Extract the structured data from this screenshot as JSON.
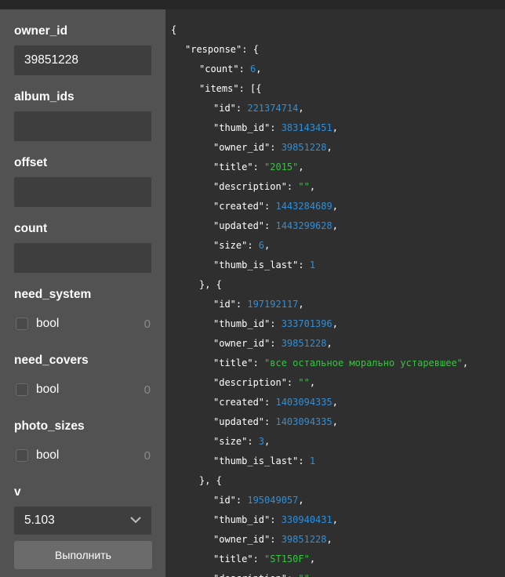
{
  "form": {
    "fields": [
      {
        "name": "owner_id",
        "type": "text",
        "value": "39851228"
      },
      {
        "name": "album_ids",
        "type": "text",
        "value": ""
      },
      {
        "name": "offset",
        "type": "text",
        "value": ""
      },
      {
        "name": "count",
        "type": "text",
        "value": ""
      },
      {
        "name": "need_system",
        "type": "bool",
        "label": "bool",
        "value": "0"
      },
      {
        "name": "need_covers",
        "type": "bool",
        "label": "bool",
        "value": "0"
      },
      {
        "name": "photo_sizes",
        "type": "bool",
        "label": "bool",
        "value": "0"
      },
      {
        "name": "v",
        "type": "select",
        "value": "5.103"
      }
    ],
    "run_label": "Выполнить"
  },
  "response_lines": [
    {
      "indent": 0,
      "parts": [
        {
          "t": "p",
          "s": "{"
        }
      ]
    },
    {
      "indent": 1,
      "parts": [
        {
          "t": "p",
          "s": "\"response\": {"
        }
      ]
    },
    {
      "indent": 2,
      "parts": [
        {
          "t": "p",
          "s": "\"count\": "
        },
        {
          "t": "n",
          "s": "6"
        },
        {
          "t": "p",
          "s": ","
        }
      ]
    },
    {
      "indent": 2,
      "parts": [
        {
          "t": "p",
          "s": "\"items\": [{"
        }
      ]
    },
    {
      "indent": 3,
      "parts": [
        {
          "t": "p",
          "s": "\"id\": "
        },
        {
          "t": "n",
          "s": "221374714"
        },
        {
          "t": "p",
          "s": ","
        }
      ]
    },
    {
      "indent": 3,
      "parts": [
        {
          "t": "p",
          "s": "\"thumb_id\": "
        },
        {
          "t": "n",
          "s": "383143451"
        },
        {
          "t": "p",
          "s": ","
        }
      ]
    },
    {
      "indent": 3,
      "parts": [
        {
          "t": "p",
          "s": "\"owner_id\": "
        },
        {
          "t": "n",
          "s": "39851228"
        },
        {
          "t": "p",
          "s": ","
        }
      ]
    },
    {
      "indent": 3,
      "parts": [
        {
          "t": "p",
          "s": "\"title\": "
        },
        {
          "t": "s",
          "s": "\"2015\""
        },
        {
          "t": "p",
          "s": ","
        }
      ]
    },
    {
      "indent": 3,
      "parts": [
        {
          "t": "p",
          "s": "\"description\": "
        },
        {
          "t": "s",
          "s": "\"\""
        },
        {
          "t": "p",
          "s": ","
        }
      ]
    },
    {
      "indent": 3,
      "parts": [
        {
          "t": "p",
          "s": "\"created\": "
        },
        {
          "t": "n",
          "s": "1443284689"
        },
        {
          "t": "p",
          "s": ","
        }
      ]
    },
    {
      "indent": 3,
      "parts": [
        {
          "t": "p",
          "s": "\"updated\": "
        },
        {
          "t": "n",
          "s": "1443299628"
        },
        {
          "t": "p",
          "s": ","
        }
      ]
    },
    {
      "indent": 3,
      "parts": [
        {
          "t": "p",
          "s": "\"size\": "
        },
        {
          "t": "n",
          "s": "6"
        },
        {
          "t": "p",
          "s": ","
        }
      ]
    },
    {
      "indent": 3,
      "parts": [
        {
          "t": "p",
          "s": "\"thumb_is_last\": "
        },
        {
          "t": "n",
          "s": "1"
        }
      ]
    },
    {
      "indent": 2,
      "parts": [
        {
          "t": "p",
          "s": "}, {"
        }
      ]
    },
    {
      "indent": 3,
      "parts": [
        {
          "t": "p",
          "s": "\"id\": "
        },
        {
          "t": "n",
          "s": "197192117"
        },
        {
          "t": "p",
          "s": ","
        }
      ]
    },
    {
      "indent": 3,
      "parts": [
        {
          "t": "p",
          "s": "\"thumb_id\": "
        },
        {
          "t": "n",
          "s": "333701396"
        },
        {
          "t": "p",
          "s": ","
        }
      ]
    },
    {
      "indent": 3,
      "parts": [
        {
          "t": "p",
          "s": "\"owner_id\": "
        },
        {
          "t": "n",
          "s": "39851228"
        },
        {
          "t": "p",
          "s": ","
        }
      ]
    },
    {
      "indent": 3,
      "parts": [
        {
          "t": "p",
          "s": "\"title\": "
        },
        {
          "t": "s",
          "s": "\"все остальное морально устаревшее\""
        },
        {
          "t": "p",
          "s": ","
        }
      ]
    },
    {
      "indent": 3,
      "parts": [
        {
          "t": "p",
          "s": "\"description\": "
        },
        {
          "t": "s",
          "s": "\"\""
        },
        {
          "t": "p",
          "s": ","
        }
      ]
    },
    {
      "indent": 3,
      "parts": [
        {
          "t": "p",
          "s": "\"created\": "
        },
        {
          "t": "n",
          "s": "1403094335"
        },
        {
          "t": "p",
          "s": ","
        }
      ]
    },
    {
      "indent": 3,
      "parts": [
        {
          "t": "p",
          "s": "\"updated\": "
        },
        {
          "t": "n",
          "s": "1403094335"
        },
        {
          "t": "p",
          "s": ","
        }
      ]
    },
    {
      "indent": 3,
      "parts": [
        {
          "t": "p",
          "s": "\"size\": "
        },
        {
          "t": "n",
          "s": "3"
        },
        {
          "t": "p",
          "s": ","
        }
      ]
    },
    {
      "indent": 3,
      "parts": [
        {
          "t": "p",
          "s": "\"thumb_is_last\": "
        },
        {
          "t": "n",
          "s": "1"
        }
      ]
    },
    {
      "indent": 2,
      "parts": [
        {
          "t": "p",
          "s": "}, {"
        }
      ]
    },
    {
      "indent": 3,
      "parts": [
        {
          "t": "p",
          "s": "\"id\": "
        },
        {
          "t": "n",
          "s": "195049057"
        },
        {
          "t": "p",
          "s": ","
        }
      ]
    },
    {
      "indent": 3,
      "parts": [
        {
          "t": "p",
          "s": "\"thumb_id\": "
        },
        {
          "t": "n",
          "s": "330940431"
        },
        {
          "t": "p",
          "s": ","
        }
      ]
    },
    {
      "indent": 3,
      "parts": [
        {
          "t": "p",
          "s": "\"owner_id\": "
        },
        {
          "t": "n",
          "s": "39851228"
        },
        {
          "t": "p",
          "s": ","
        }
      ]
    },
    {
      "indent": 3,
      "parts": [
        {
          "t": "p",
          "s": "\"title\": "
        },
        {
          "t": "s",
          "s": "\"ST150F\""
        },
        {
          "t": "p",
          "s": ","
        }
      ]
    },
    {
      "indent": 3,
      "parts": [
        {
          "t": "p",
          "s": "\"description\": "
        },
        {
          "t": "s",
          "s": "\"\""
        }
      ]
    }
  ],
  "colors": {
    "number": "#2f8fd8",
    "string": "#35c440",
    "sidebar_bg": "#525252",
    "code_bg": "#2f2f2f"
  },
  "icons": {
    "select_arrow": "chevron-down-icon"
  }
}
